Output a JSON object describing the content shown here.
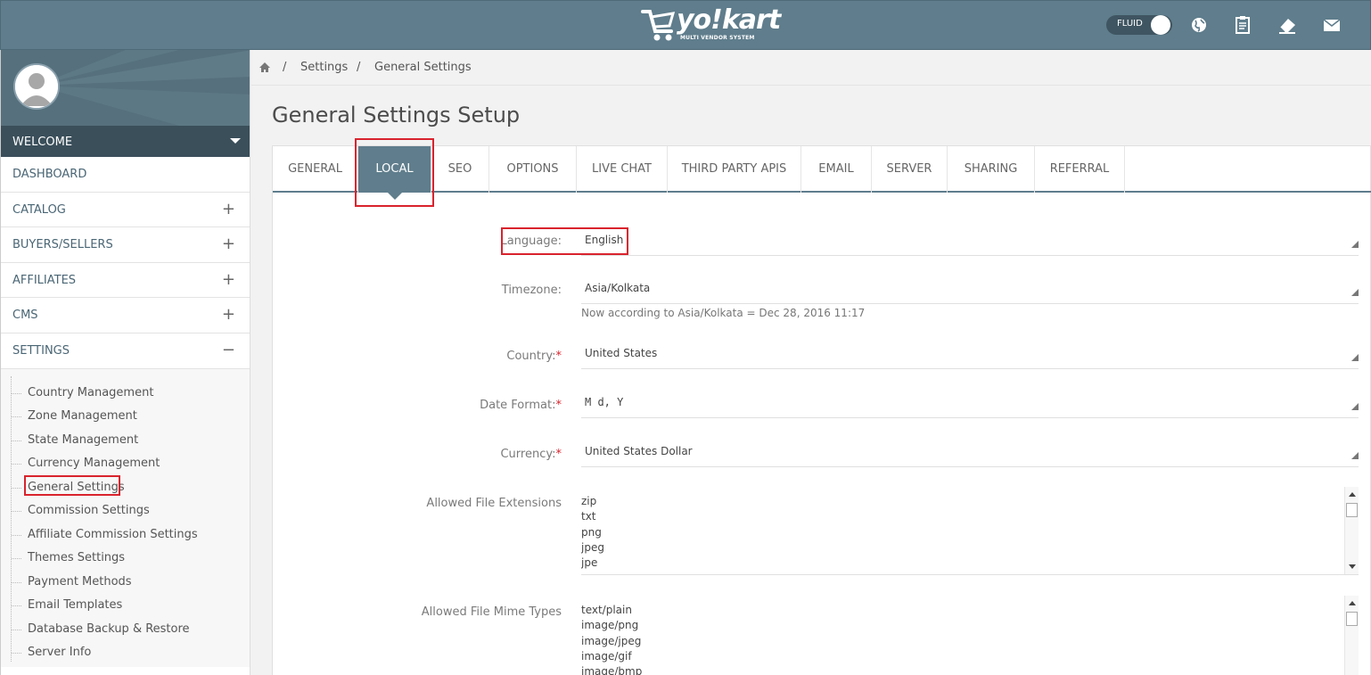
{
  "header": {
    "logo_text": "yo!kart",
    "logo_sub": "MULTI VENDOR SYSTEM",
    "fluid_label": "FLUID",
    "icons": [
      "globe-icon",
      "clipboard-icon",
      "eraser-icon",
      "mail-icon"
    ]
  },
  "sidebar": {
    "welcome": "WELCOME",
    "items": [
      {
        "label": "DASHBOARD",
        "toggle": ""
      },
      {
        "label": "CATALOG",
        "toggle": "+"
      },
      {
        "label": "BUYERS/SELLERS",
        "toggle": "+"
      },
      {
        "label": "AFFILIATES",
        "toggle": "+"
      },
      {
        "label": "CMS",
        "toggle": "+"
      },
      {
        "label": "SETTINGS",
        "toggle": "−"
      }
    ],
    "settings_sub": [
      "Country Management",
      "Zone Management",
      "State Management",
      "Currency Management",
      "General Settings",
      "Commission Settings",
      "Affiliate Commission Settings",
      "Themes Settings",
      "Payment Methods",
      "Email Templates",
      "Database Backup & Restore",
      "Server Info"
    ]
  },
  "breadcrumb": {
    "sep": "/",
    "items": [
      "Settings",
      "General Settings"
    ]
  },
  "page": {
    "title": "General Settings Setup"
  },
  "tabs": [
    "GENERAL",
    "LOCAL",
    "SEO",
    "OPTIONS",
    "LIVE CHAT",
    "THIRD PARTY APIS",
    "EMAIL",
    "SERVER",
    "SHARING",
    "REFERRAL"
  ],
  "active_tab": "LOCAL",
  "form": {
    "language": {
      "label": "Language:",
      "value": "English"
    },
    "timezone": {
      "label": "Timezone:",
      "value": "Asia/Kolkata",
      "hint": "Now according to Asia/Kolkata = Dec 28, 2016 11:17"
    },
    "country": {
      "label": "Country:",
      "required": "*",
      "value": "United States"
    },
    "date_format": {
      "label": "Date Format:",
      "required": "*",
      "value": "M d, Y"
    },
    "currency": {
      "label": "Currency:",
      "required": "*",
      "value": "United States Dollar"
    },
    "file_ext": {
      "label": "Allowed File Extensions",
      "lines": [
        "zip",
        "txt",
        "png",
        "jpeg",
        "jpe"
      ]
    },
    "mime": {
      "label": "Allowed File Mime Types",
      "lines": [
        "text/plain",
        "image/png",
        "image/jpeg",
        "image/gif",
        "image/bmp"
      ]
    }
  },
  "colors": {
    "topbar": "#5f7d8c",
    "accent": "#5f7d8c",
    "highlight": "#d9232d"
  }
}
